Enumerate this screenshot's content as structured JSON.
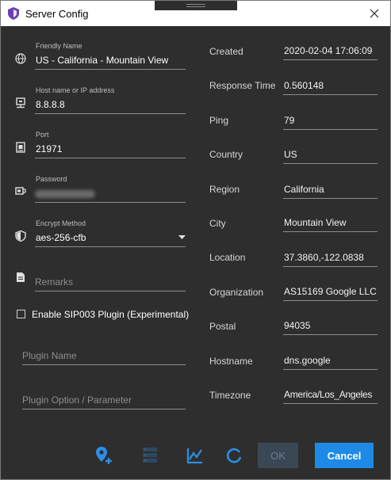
{
  "window": {
    "title": "Server Config"
  },
  "left": {
    "friendly_name": {
      "label": "Friendly Name",
      "value": "US - California - Mountain View"
    },
    "host": {
      "label": "Host name or IP address",
      "value": "8.8.8.8"
    },
    "port": {
      "label": "Port",
      "value": "21971"
    },
    "password": {
      "label": "Password"
    },
    "encrypt": {
      "label": "Encrypt Method",
      "value": "aes-256-cfb"
    },
    "remarks": {
      "placeholder": "Remarks"
    },
    "sip003": {
      "label": "Enable SIP003 Plugin (Experimental)",
      "checked": false
    },
    "plugin_name": {
      "placeholder": "Plugin Name"
    },
    "plugin_option": {
      "placeholder": "Plugin Option / Parameter"
    }
  },
  "info": [
    {
      "label": "Created",
      "value": "2020-02-04 17:06:09"
    },
    {
      "label": "Response Time",
      "value": "0.560148"
    },
    {
      "label": "Ping",
      "value": "79"
    },
    {
      "label": "Country",
      "value": "US"
    },
    {
      "label": "Region",
      "value": "California"
    },
    {
      "label": "City",
      "value": "Mountain View"
    },
    {
      "label": "Location",
      "value": "37.3860,-122.0838"
    },
    {
      "label": "Organization",
      "value": "AS15169 Google LLC"
    },
    {
      "label": "Postal",
      "value": "94035"
    },
    {
      "label": "Hostname",
      "value": "dns.google"
    },
    {
      "label": "Timezone",
      "value": "America/Los_Angeles"
    }
  ],
  "footer": {
    "tools": [
      "add-location-icon",
      "server-icon",
      "chart-icon",
      "refresh-icon"
    ],
    "ok_label": "OK",
    "cancel_label": "Cancel"
  },
  "colors": {
    "background": "#2e2e2e",
    "accent": "#1f8ae6",
    "disabled_button": "#3a4856",
    "tool_icon": "#2b8fe6"
  }
}
